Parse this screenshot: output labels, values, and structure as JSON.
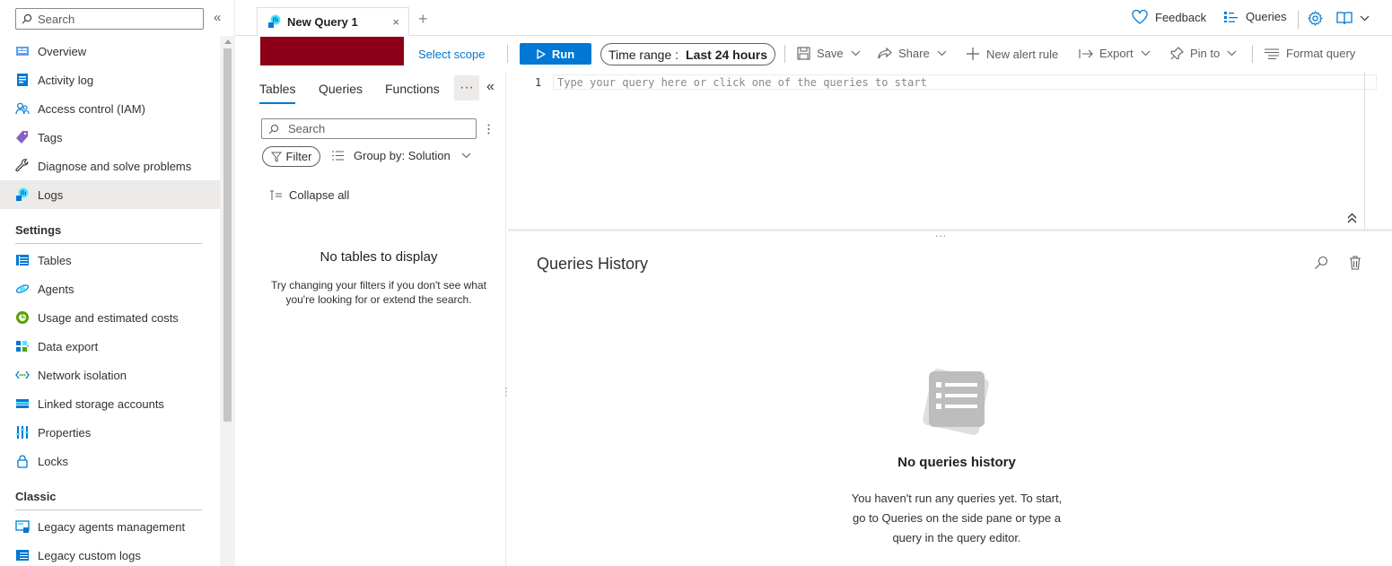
{
  "leftnav": {
    "search_placeholder": "Search",
    "collapse_glyph": "«",
    "items": [
      {
        "label": "Overview",
        "icon": "overview-icon"
      },
      {
        "label": "Activity log",
        "icon": "activity-log-icon"
      },
      {
        "label": "Access control (IAM)",
        "icon": "people-icon"
      },
      {
        "label": "Tags",
        "icon": "tag-icon"
      },
      {
        "label": "Diagnose and solve problems",
        "icon": "wrench-icon"
      },
      {
        "label": "Logs",
        "icon": "logs-icon",
        "selected": true
      }
    ],
    "settings_header": "Settings",
    "settings_items": [
      {
        "label": "Tables",
        "icon": "table-icon"
      },
      {
        "label": "Agents",
        "icon": "agents-icon"
      },
      {
        "label": "Usage and estimated costs",
        "icon": "usage-icon"
      },
      {
        "label": "Data export",
        "icon": "data-export-icon"
      },
      {
        "label": "Network isolation",
        "icon": "network-icon"
      },
      {
        "label": "Linked storage accounts",
        "icon": "storage-icon"
      },
      {
        "label": "Properties",
        "icon": "properties-icon"
      },
      {
        "label": "Locks",
        "icon": "lock-icon"
      }
    ],
    "classic_header": "Classic",
    "classic_items": [
      {
        "label": "Legacy agents management",
        "icon": "legacy-agents-icon"
      },
      {
        "label": "Legacy custom logs",
        "icon": "legacy-logs-icon"
      }
    ]
  },
  "tabbar": {
    "tab_label": "New Query 1",
    "close_glyph": "×",
    "add_glyph": "+",
    "feedback": "Feedback",
    "queries": "Queries"
  },
  "cmdbar": {
    "select_scope": "Select scope",
    "run": "Run",
    "time_range_label": "Time range :",
    "time_range_value": "Last 24 hours",
    "save": "Save",
    "share": "Share",
    "new_alert_rule": "New alert rule",
    "export": "Export",
    "pin_to": "Pin to",
    "format_query": "Format query",
    "scope_color": "#8b0017"
  },
  "schema": {
    "tabs": [
      "Tables",
      "Queries",
      "Functions"
    ],
    "more_glyph": "···",
    "collapse_glyph": "«",
    "search_placeholder": "Search",
    "filter": "Filter",
    "group_by": "Group by: Solution",
    "collapse_all": "Collapse all",
    "empty_title": "No tables to display",
    "empty_sub": "Try changing your filters if you don't see what you're looking for or extend the search."
  },
  "editor": {
    "line_number": "1",
    "placeholder": "Type your query here or click one of the queries to start",
    "splitter": "..."
  },
  "history": {
    "title": "Queries History",
    "empty_title": "No queries history",
    "empty_sub": "You haven't run any queries yet. To start, go to Queries on the side pane or type a query in the query editor."
  },
  "colors": {
    "accent": "#0078d4",
    "selected_bg": "#edebe9"
  }
}
